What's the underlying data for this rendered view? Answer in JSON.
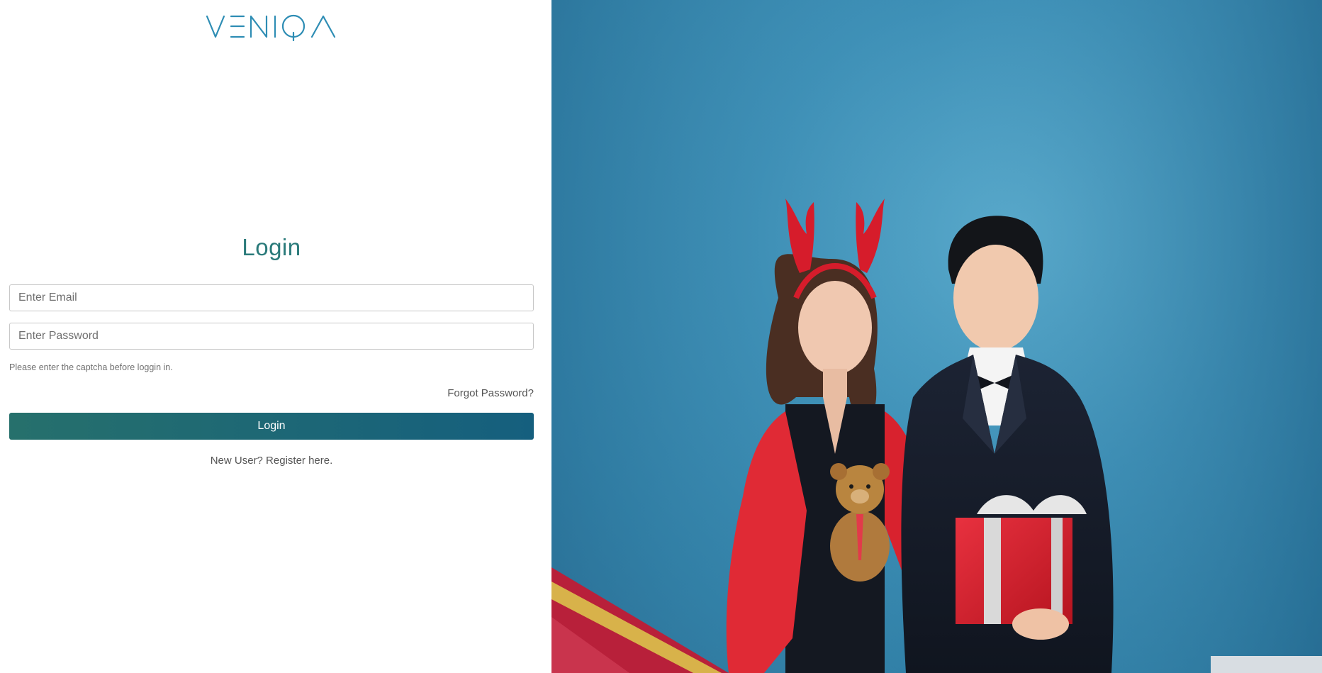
{
  "brand": {
    "logo_text": "VENIQA",
    "logo_color": "#2e8db4"
  },
  "login": {
    "title": "Login",
    "email_placeholder": "Enter Email",
    "password_placeholder": "Enter Password",
    "captcha_note": "Please enter the captcha before loggin in.",
    "forgot_password": "Forgot Password?",
    "login_button": "Login",
    "register_prompt": "New User? Register here."
  },
  "colors": {
    "title": "#2a7a7a",
    "button_start": "#26706c",
    "button_end": "#155f7e",
    "background_wall": "#3d8fb6"
  },
  "hero_image": {
    "alt": "hero-photo"
  }
}
